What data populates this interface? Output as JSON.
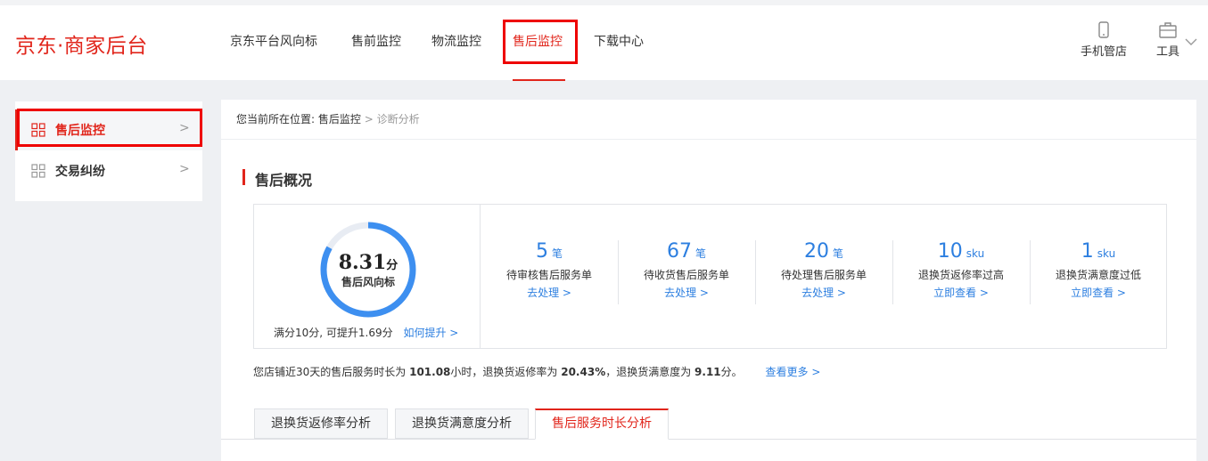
{
  "header": {
    "logo": "京东·商家后台",
    "nav": [
      {
        "label": "京东平台风向标"
      },
      {
        "label": "售前监控"
      },
      {
        "label": "物流监控"
      },
      {
        "label": "售后监控",
        "active": true
      },
      {
        "label": "下载中心"
      }
    ],
    "tools": [
      {
        "label": "手机管店",
        "icon": "mobile-icon"
      },
      {
        "label": "工具",
        "icon": "toolbox-icon"
      }
    ]
  },
  "sidebar": {
    "items": [
      {
        "label": "售后监控",
        "icon": "grid-icon",
        "active": true
      },
      {
        "label": "交易纠纷",
        "icon": "grid-icon"
      }
    ]
  },
  "breadcrumb": {
    "prefix": "您当前所在位置:",
    "parent": "售后监控",
    "separator": ">",
    "current": "诊断分析"
  },
  "overview": {
    "title": "售后概况",
    "score": {
      "value": "8.31",
      "unit": "分",
      "label": "售后风向标",
      "fraction": 0.831,
      "note": "满分10分, 可提升1.69分",
      "link": "如何提升 >"
    },
    "stats": [
      {
        "value": "5",
        "unit": "笔",
        "desc": "待审核售后服务单",
        "action": "去处理 >"
      },
      {
        "value": "67",
        "unit": "笔",
        "desc": "待收货售后服务单",
        "action": "去处理 >"
      },
      {
        "value": "20",
        "unit": "笔",
        "desc": "待处理售后服务单",
        "action": "去处理 >"
      },
      {
        "value": "10",
        "unit": "sku",
        "desc": "退换货返修率过高",
        "action": "立即查看 >"
      },
      {
        "value": "1",
        "unit": "sku",
        "desc": "退换货满意度过低",
        "action": "立即查看 >"
      }
    ],
    "summary": {
      "t1": "您店铺近30天的售后服务时长为 ",
      "v1": "101.08",
      "t2": "小时，退换货返修率为 ",
      "v2": "20.43%",
      "t3": "，退换货满意度为 ",
      "v3": "9.11",
      "t4": "分。",
      "link": "查看更多 >"
    }
  },
  "tabs": [
    {
      "label": "退换货返修率分析"
    },
    {
      "label": "退换货满意度分析"
    },
    {
      "label": "售后服务时长分析",
      "active": true
    }
  ],
  "colors": {
    "brand": "#e1251b",
    "link": "#2d7fe0",
    "gauge_track": "#e8ecf3",
    "highlight": "#ee0000"
  }
}
